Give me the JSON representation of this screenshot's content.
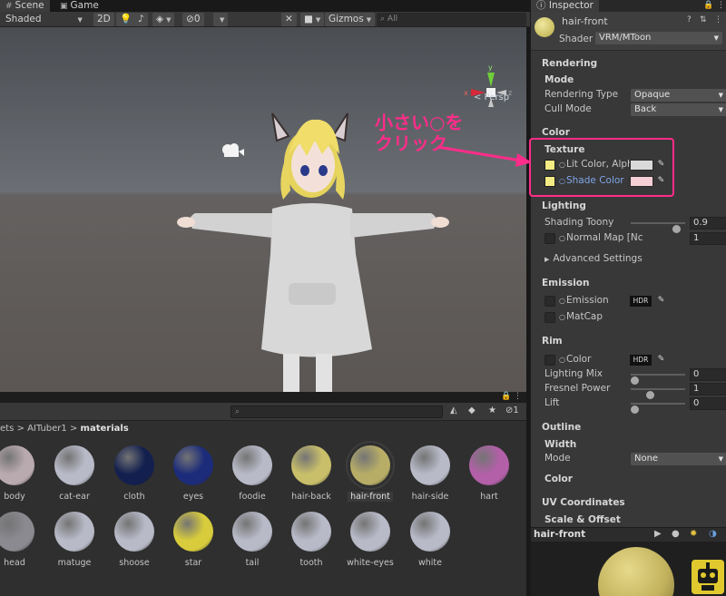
{
  "tabs": [
    {
      "label": "Scene",
      "glyph": "#"
    },
    {
      "label": "Game",
      "glyph": "▣"
    }
  ],
  "scene_toolbar": {
    "shading_mode": "Shaded",
    "mode_2d": "2D",
    "hidden_count": "0",
    "gizmos": "Gizmos",
    "search_placeholder": "All"
  },
  "viewport": {
    "gizmo_axes": {
      "x": "x",
      "y": "y",
      "z": "z"
    },
    "projection_label": "< Persp"
  },
  "annotation": {
    "line1": "小さい○を",
    "line2": "クリック",
    "color": "#ff2c8a"
  },
  "project": {
    "breadcrumb": {
      "prefix": "ets",
      "sep": ">",
      "folder1": "AITuber1",
      "folder2": "materials"
    },
    "hidden_count": "1",
    "search_placeholder": "",
    "assets_row1": [
      {
        "name": "body",
        "color": "#b9aab0"
      },
      {
        "name": "cat-ear",
        "color": "#b8bac8"
      },
      {
        "name": "cloth",
        "color": "#13204f"
      },
      {
        "name": "eyes",
        "color": "#1d2c7a"
      },
      {
        "name": "foodie",
        "color": "#b8bac8"
      },
      {
        "name": "hair-back",
        "color": "#c9bf6a"
      },
      {
        "name": "hair-front",
        "color": "#b7ad67",
        "selected": true
      },
      {
        "name": "hair-side",
        "color": "#b8bac8"
      },
      {
        "name": "hart",
        "color": "#b360a8"
      }
    ],
    "assets_row2": [
      {
        "name": "head",
        "color": "#8a8a90"
      },
      {
        "name": "matuge",
        "color": "#b8bac8"
      },
      {
        "name": "shoose",
        "color": "#b8bac8"
      },
      {
        "name": "star",
        "color": "#d8cc3c"
      },
      {
        "name": "tail",
        "color": "#b8bac8"
      },
      {
        "name": "tooth",
        "color": "#b8bac8"
      },
      {
        "name": "white-eyes",
        "color": "#b8bac8"
      },
      {
        "name": "white",
        "color": "#b8bac8"
      }
    ]
  },
  "inspector": {
    "tab_label": "Inspector",
    "material_name": "hair-front",
    "shader_label": "Shader",
    "shader_value": "VRM/MToon",
    "rendering": {
      "section": "Rendering",
      "mode_header": "Mode",
      "rendering_type_label": "Rendering Type",
      "rendering_type_value": "Opaque",
      "cull_mode_label": "Cull Mode",
      "cull_mode_value": "Back"
    },
    "color": {
      "section": "Color",
      "texture_header": "Texture",
      "lit_color_label": "Lit Color, Alpha",
      "lit_color_hex": "#d9d9d9",
      "shade_color_label": "Shade Color",
      "shade_color_hex": "#f6cfd6"
    },
    "lighting": {
      "section": "Lighting",
      "shading_toony_label": "Shading Toony",
      "shading_toony_value": "0.9",
      "shading_toony_fraction": 0.9,
      "normal_map_label": "Normal Map [Nc",
      "normal_map_value": "1",
      "advanced_label": "Advanced Settings"
    },
    "emission": {
      "section": "Emission",
      "emission_label": "Emission",
      "hdr_label": "HDR",
      "matcap_label": "MatCap"
    },
    "rim": {
      "section": "Rim",
      "color_label": "Color",
      "hdr_label": "HDR",
      "lighting_mix_label": "Lighting Mix",
      "lighting_mix_value": "0",
      "lighting_mix_fraction": 0,
      "fresnel_power_label": "Fresnel Power",
      "fresnel_power_value": "1",
      "fresnel_power_fraction": 0.33,
      "lift_label": "Lift",
      "lift_value": "0",
      "lift_fraction": 0
    },
    "outline": {
      "section": "Outline",
      "width_header": "Width",
      "mode_label": "Mode",
      "mode_value": "None",
      "color_header": "Color"
    },
    "uv": {
      "section": "UV Coordinates",
      "scale_offset_header": "Scale & Offset"
    },
    "preview_name": "hair-front"
  }
}
